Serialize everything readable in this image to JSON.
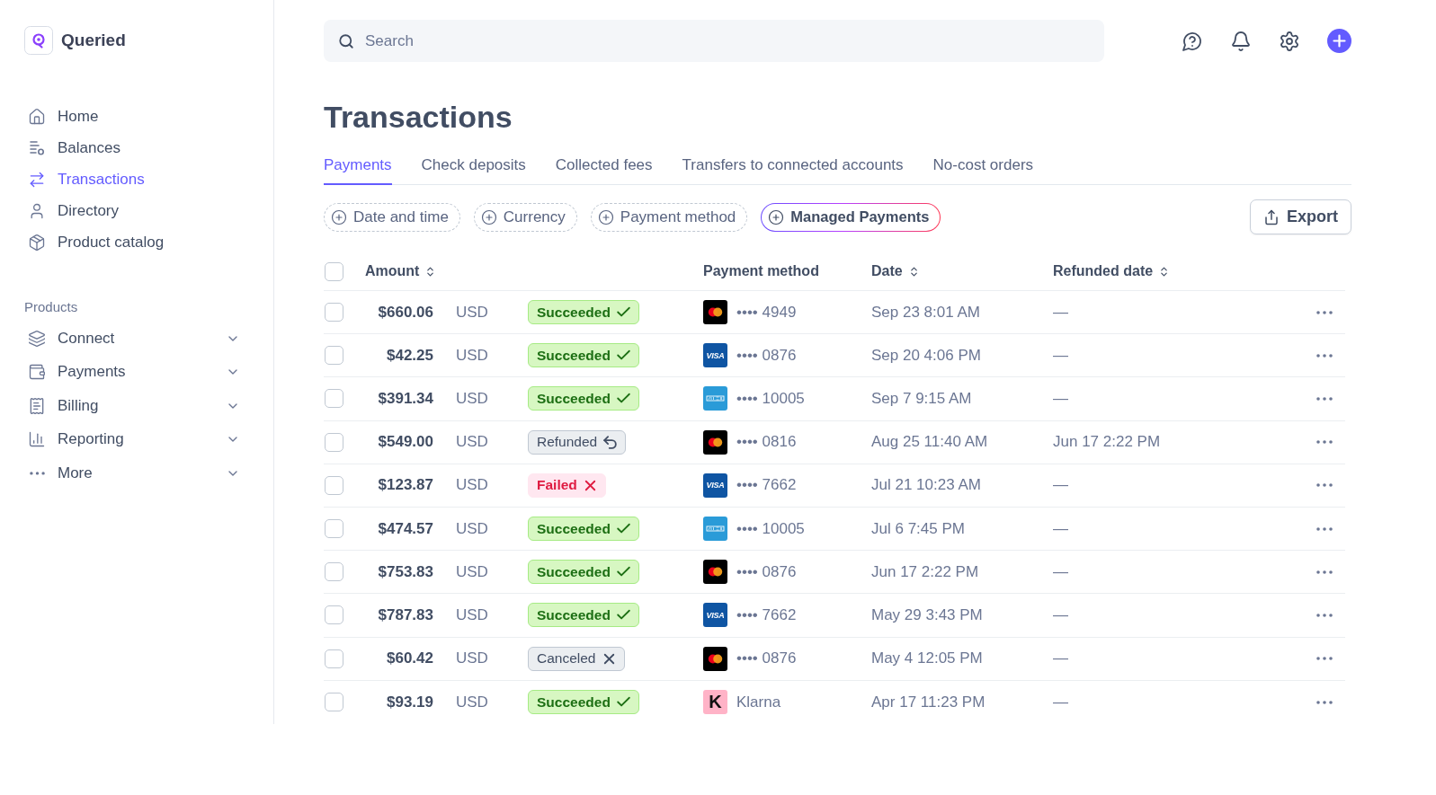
{
  "sidebar": {
    "brand": "Queried",
    "nav": [
      {
        "label": "Home",
        "selected": false
      },
      {
        "label": "Balances",
        "selected": false
      },
      {
        "label": "Transactions",
        "selected": true
      },
      {
        "label": "Directory",
        "selected": false
      },
      {
        "label": "Product catalog",
        "selected": false
      }
    ],
    "section": {
      "title": "Products",
      "items": [
        {
          "label": "Connect",
          "expanded": false
        },
        {
          "label": "Payments",
          "expanded": false
        },
        {
          "label": "Billing",
          "expanded": false
        },
        {
          "label": "Reporting",
          "expanded": false
        },
        {
          "label": "More",
          "expanded": false
        }
      ]
    }
  },
  "search": {
    "placeholder": "Search"
  },
  "page_title": "Transactions",
  "tabs": [
    {
      "label": "Payments",
      "selected": true
    },
    {
      "label": "Check deposits",
      "selected": false
    },
    {
      "label": "Collected fees",
      "selected": false
    },
    {
      "label": "Transfers to connected accounts",
      "selected": false
    },
    {
      "label": "No-cost orders",
      "selected": false
    }
  ],
  "filters": [
    {
      "label": "Date and time",
      "kind": "dashed"
    },
    {
      "label": "Currency",
      "kind": "dashed"
    },
    {
      "label": "Payment method",
      "kind": "dashed"
    },
    {
      "label": "Managed Payments",
      "kind": "highlighted"
    }
  ],
  "export_button": {
    "label": "Export"
  },
  "table": {
    "select_all": {
      "checked": false
    },
    "columns": [
      {
        "label": "Amount",
        "sortable": true
      },
      {
        "label": "Payment method",
        "sortable": false
      },
      {
        "label": "Date",
        "sortable": true
      },
      {
        "label": "Refunded date",
        "sortable": true
      }
    ],
    "rows": [
      {
        "checked": false,
        "amount": "$660.06",
        "currency": "USD",
        "status": {
          "label": "Succeeded",
          "kind": "succeeded"
        },
        "method": {
          "kind": "mastercard",
          "label": "•••• 4949"
        },
        "date": "Sep 23 8:01 AM",
        "refunded_date": "—"
      },
      {
        "checked": false,
        "amount": "$42.25",
        "currency": "USD",
        "status": {
          "label": "Succeeded",
          "kind": "succeeded"
        },
        "method": {
          "kind": "visa",
          "logo": "VISA",
          "label": "•••• 0876"
        },
        "date": "Sep 20 4:06 PM",
        "refunded_date": "—"
      },
      {
        "checked": false,
        "amount": "$391.34",
        "currency": "USD",
        "status": {
          "label": "Succeeded",
          "kind": "succeeded"
        },
        "method": {
          "kind": "amex",
          "label": "•••• 10005"
        },
        "date": "Sep 7 9:15 AM",
        "refunded_date": "—"
      },
      {
        "checked": false,
        "amount": "$549.00",
        "currency": "USD",
        "status": {
          "label": "Refunded",
          "kind": "refunded"
        },
        "method": {
          "kind": "mastercard",
          "label": "•••• 0816"
        },
        "date": "Aug 25 11:40 AM",
        "refunded_date": "Jun 17 2:22 PM"
      },
      {
        "checked": false,
        "amount": "$123.87",
        "currency": "USD",
        "status": {
          "label": "Failed",
          "kind": "failed"
        },
        "method": {
          "kind": "visa",
          "logo": "VISA",
          "label": "•••• 7662"
        },
        "date": "Jul 21 10:23 AM",
        "refunded_date": "—"
      },
      {
        "checked": false,
        "amount": "$474.57",
        "currency": "USD",
        "status": {
          "label": "Succeeded",
          "kind": "succeeded"
        },
        "method": {
          "kind": "amex",
          "label": "•••• 10005"
        },
        "date": "Jul 6 7:45 PM",
        "refunded_date": "—"
      },
      {
        "checked": false,
        "amount": "$753.83",
        "currency": "USD",
        "status": {
          "label": "Succeeded",
          "kind": "succeeded"
        },
        "method": {
          "kind": "mastercard",
          "label": "•••• 0876"
        },
        "date": "Jun 17 2:22 PM",
        "refunded_date": "—"
      },
      {
        "checked": false,
        "amount": "$787.83",
        "currency": "USD",
        "status": {
          "label": "Succeeded",
          "kind": "succeeded"
        },
        "method": {
          "kind": "visa",
          "logo": "VISA",
          "label": "•••• 7662"
        },
        "date": "May 29 3:43 PM",
        "refunded_date": "—"
      },
      {
        "checked": false,
        "amount": "$60.42",
        "currency": "USD",
        "status": {
          "label": "Canceled",
          "kind": "canceled"
        },
        "method": {
          "kind": "mastercard",
          "label": "•••• 0876"
        },
        "date": "May 4 12:05 PM",
        "refunded_date": "—"
      },
      {
        "checked": false,
        "amount": "$93.19",
        "currency": "USD",
        "status": {
          "label": "Succeeded",
          "kind": "succeeded"
        },
        "method": {
          "kind": "klarna",
          "logo": "K",
          "label": "Klarna"
        },
        "date": "Apr 17 11:23 PM",
        "refunded_date": "—"
      }
    ]
  }
}
